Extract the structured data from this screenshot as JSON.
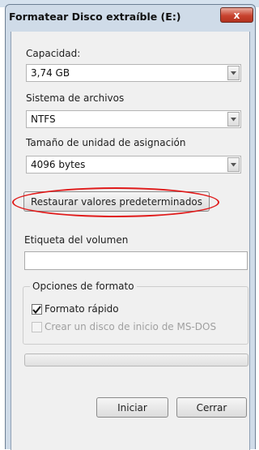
{
  "window": {
    "title": "Formatear Disco extraíble (E:)",
    "close_label": "x"
  },
  "capacity": {
    "label": "Capacidad:",
    "value": "3,74 GB"
  },
  "filesystem": {
    "label": "Sistema de archivos",
    "value": "NTFS"
  },
  "allocation": {
    "label": "Tamaño de unidad de asignación",
    "value": "4096 bytes"
  },
  "restore_defaults_label": "Restaurar valores predeterminados",
  "volume_label": {
    "label": "Etiqueta del volumen",
    "value": ""
  },
  "format_options": {
    "legend": "Opciones de formato",
    "quick_format": {
      "label": "Formato rápido",
      "checked": true
    },
    "msdos_boot": {
      "label": "Crear un disco de inicio de MS-DOS",
      "checked": false,
      "enabled": false
    }
  },
  "progress": {
    "value": 0
  },
  "buttons": {
    "start": "Iniciar",
    "close": "Cerrar"
  },
  "colors": {
    "highlight_ellipse": "#e01b1b",
    "window_frame": "#cfdbe8",
    "close_button": "#c8432f"
  }
}
